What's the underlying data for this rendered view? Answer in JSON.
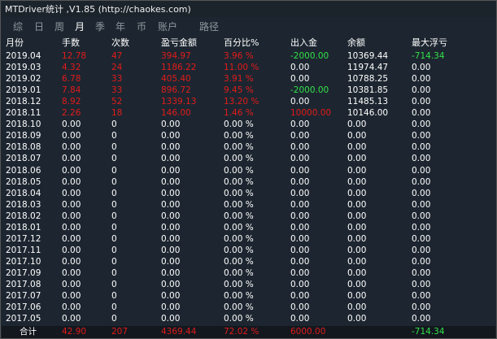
{
  "window": {
    "title": "MTDriver统计 ,V1.85 (http://chaokes.com)"
  },
  "tabs": [
    {
      "label": "综",
      "active": false
    },
    {
      "label": "日",
      "active": false
    },
    {
      "label": "周",
      "active": false
    },
    {
      "label": "月",
      "active": true
    },
    {
      "label": "季",
      "active": false
    },
    {
      "label": "年",
      "active": false
    },
    {
      "label": "币",
      "active": false
    },
    {
      "label": "账户",
      "active": false
    },
    {
      "label": "路径",
      "active": false
    }
  ],
  "columns": [
    "月份",
    "手数",
    "次数",
    "盈亏金额",
    "百分比%",
    "出入金",
    "余额",
    "最大浮亏"
  ],
  "colors": {
    "positive": "#e11b1b",
    "negative": "#33e04a",
    "neutral": "#ffffff",
    "background": "#1d2630"
  },
  "rows": [
    {
      "month": "2019.04",
      "lots": "12.78",
      "count": "47",
      "pnl": "394.97",
      "pct": "3.96 %",
      "flow": "-2000.00",
      "balance": "10369.44",
      "maxdd": "-714.34",
      "hl": true,
      "flowc": "green",
      "ddc": "green"
    },
    {
      "month": "2019.03",
      "lots": "4.32",
      "count": "24",
      "pnl": "1186.22",
      "pct": "11.00 %",
      "flow": "0.00",
      "balance": "11974.47",
      "maxdd": "0.00",
      "hl": true,
      "flowc": "white",
      "ddc": "white"
    },
    {
      "month": "2019.02",
      "lots": "6.78",
      "count": "33",
      "pnl": "405.40",
      "pct": "3.91 %",
      "flow": "0.00",
      "balance": "10788.25",
      "maxdd": "0.00",
      "hl": true,
      "flowc": "white",
      "ddc": "white"
    },
    {
      "month": "2019.01",
      "lots": "7.84",
      "count": "33",
      "pnl": "896.72",
      "pct": "9.45 %",
      "flow": "-2000.00",
      "balance": "10381.85",
      "maxdd": "0.00",
      "hl": true,
      "flowc": "green",
      "ddc": "white"
    },
    {
      "month": "2018.12",
      "lots": "8.92",
      "count": "52",
      "pnl": "1339.13",
      "pct": "13.20 %",
      "flow": "0.00",
      "balance": "11485.13",
      "maxdd": "0.00",
      "hl": true,
      "flowc": "white",
      "ddc": "white"
    },
    {
      "month": "2018.11",
      "lots": "2.26",
      "count": "18",
      "pnl": "146.00",
      "pct": "1.46 %",
      "flow": "10000.00",
      "balance": "10146.00",
      "maxdd": "0.00",
      "hl": true,
      "flowc": "red",
      "ddc": "white"
    },
    {
      "month": "2018.10",
      "lots": "0.00",
      "count": "0",
      "pnl": "0.00",
      "pct": "0.00 %",
      "flow": "0.00",
      "balance": "0.00",
      "maxdd": "0.00",
      "hl": false,
      "flowc": "white",
      "ddc": "white"
    },
    {
      "month": "2018.09",
      "lots": "0.00",
      "count": "0",
      "pnl": "0.00",
      "pct": "0.00 %",
      "flow": "0.00",
      "balance": "0.00",
      "maxdd": "0.00",
      "hl": false,
      "flowc": "white",
      "ddc": "white"
    },
    {
      "month": "2018.08",
      "lots": "0.00",
      "count": "0",
      "pnl": "0.00",
      "pct": "0.00 %",
      "flow": "0.00",
      "balance": "0.00",
      "maxdd": "0.00",
      "hl": false,
      "flowc": "white",
      "ddc": "white"
    },
    {
      "month": "2018.07",
      "lots": "0.00",
      "count": "0",
      "pnl": "0.00",
      "pct": "0.00 %",
      "flow": "0.00",
      "balance": "0.00",
      "maxdd": "0.00",
      "hl": false,
      "flowc": "white",
      "ddc": "white"
    },
    {
      "month": "2018.06",
      "lots": "0.00",
      "count": "0",
      "pnl": "0.00",
      "pct": "0.00 %",
      "flow": "0.00",
      "balance": "0.00",
      "maxdd": "0.00",
      "hl": false,
      "flowc": "white",
      "ddc": "white"
    },
    {
      "month": "2018.05",
      "lots": "0.00",
      "count": "0",
      "pnl": "0.00",
      "pct": "0.00 %",
      "flow": "0.00",
      "balance": "0.00",
      "maxdd": "0.00",
      "hl": false,
      "flowc": "white",
      "ddc": "white"
    },
    {
      "month": "2018.04",
      "lots": "0.00",
      "count": "0",
      "pnl": "0.00",
      "pct": "0.00 %",
      "flow": "0.00",
      "balance": "0.00",
      "maxdd": "0.00",
      "hl": false,
      "flowc": "white",
      "ddc": "white"
    },
    {
      "month": "2018.03",
      "lots": "0.00",
      "count": "0",
      "pnl": "0.00",
      "pct": "0.00 %",
      "flow": "0.00",
      "balance": "0.00",
      "maxdd": "0.00",
      "hl": false,
      "flowc": "white",
      "ddc": "white"
    },
    {
      "month": "2018.02",
      "lots": "0.00",
      "count": "0",
      "pnl": "0.00",
      "pct": "0.00 %",
      "flow": "0.00",
      "balance": "0.00",
      "maxdd": "0.00",
      "hl": false,
      "flowc": "white",
      "ddc": "white"
    },
    {
      "month": "2018.01",
      "lots": "0.00",
      "count": "0",
      "pnl": "0.00",
      "pct": "0.00 %",
      "flow": "0.00",
      "balance": "0.00",
      "maxdd": "0.00",
      "hl": false,
      "flowc": "white",
      "ddc": "white"
    },
    {
      "month": "2017.12",
      "lots": "0.00",
      "count": "0",
      "pnl": "0.00",
      "pct": "0.00 %",
      "flow": "0.00",
      "balance": "0.00",
      "maxdd": "0.00",
      "hl": false,
      "flowc": "white",
      "ddc": "white"
    },
    {
      "month": "2017.11",
      "lots": "0.00",
      "count": "0",
      "pnl": "0.00",
      "pct": "0.00 %",
      "flow": "0.00",
      "balance": "0.00",
      "maxdd": "0.00",
      "hl": false,
      "flowc": "white",
      "ddc": "white"
    },
    {
      "month": "2017.10",
      "lots": "0.00",
      "count": "0",
      "pnl": "0.00",
      "pct": "0.00 %",
      "flow": "0.00",
      "balance": "0.00",
      "maxdd": "0.00",
      "hl": false,
      "flowc": "white",
      "ddc": "white"
    },
    {
      "month": "2017.09",
      "lots": "0.00",
      "count": "0",
      "pnl": "0.00",
      "pct": "0.00 %",
      "flow": "0.00",
      "balance": "0.00",
      "maxdd": "0.00",
      "hl": false,
      "flowc": "white",
      "ddc": "white"
    },
    {
      "month": "2017.08",
      "lots": "0.00",
      "count": "0",
      "pnl": "0.00",
      "pct": "0.00 %",
      "flow": "0.00",
      "balance": "0.00",
      "maxdd": "0.00",
      "hl": false,
      "flowc": "white",
      "ddc": "white"
    },
    {
      "month": "2017.07",
      "lots": "0.00",
      "count": "0",
      "pnl": "0.00",
      "pct": "0.00 %",
      "flow": "0.00",
      "balance": "0.00",
      "maxdd": "0.00",
      "hl": false,
      "flowc": "white",
      "ddc": "white"
    },
    {
      "month": "2017.06",
      "lots": "0.00",
      "count": "0",
      "pnl": "0.00",
      "pct": "0.00 %",
      "flow": "0.00",
      "balance": "0.00",
      "maxdd": "0.00",
      "hl": false,
      "flowc": "white",
      "ddc": "white"
    },
    {
      "month": "2017.05",
      "lots": "0.00",
      "count": "0",
      "pnl": "0.00",
      "pct": "0.00 %",
      "flow": "0.00",
      "balance": "0.00",
      "maxdd": "0.00",
      "hl": false,
      "flowc": "white",
      "ddc": "white"
    }
  ],
  "total": {
    "label": "合计",
    "lots": "42.90",
    "count": "207",
    "pnl": "4369.44",
    "pct": "72.02 %",
    "flow": "6000.00",
    "balance": "",
    "maxdd": "-714.34"
  }
}
